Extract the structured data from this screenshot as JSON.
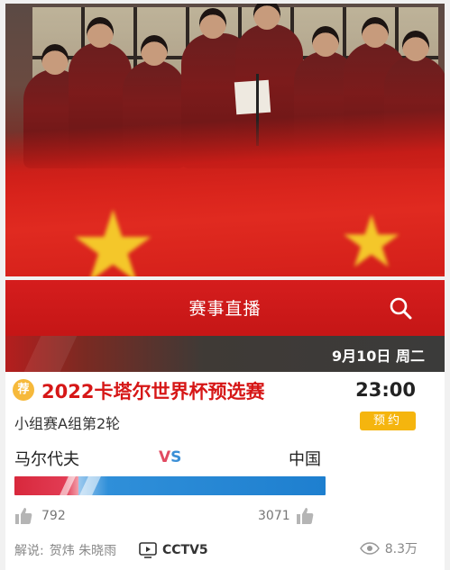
{
  "header": {
    "title": "赛事直播",
    "search_icon": "search-icon"
  },
  "date": "9月10日 周二",
  "match": {
    "badge": "荐",
    "title": "2022卡塔尔世界杯预选赛",
    "time": "23:00",
    "round": "小组赛A组第2轮",
    "reserve_label": "预约",
    "team_home": "马尔代夫",
    "vs_v": "V",
    "vs_s": "S",
    "team_away": "中国",
    "support_home": 792,
    "support_away": 3071,
    "support_home_label": "792",
    "support_away_label": "3071"
  },
  "footer": {
    "commentary_label": "解说:",
    "commentators": "贺炜 朱晓雨",
    "channel": "CCTV5",
    "views": "8.3万"
  },
  "colors": {
    "header_red": "#d51d1d",
    "title_red": "#d61717",
    "reserve_yellow": "#f5b50e",
    "badge_orange": "#f6b93b",
    "home_red": "#e14a61",
    "away_blue": "#3b8fd6"
  }
}
